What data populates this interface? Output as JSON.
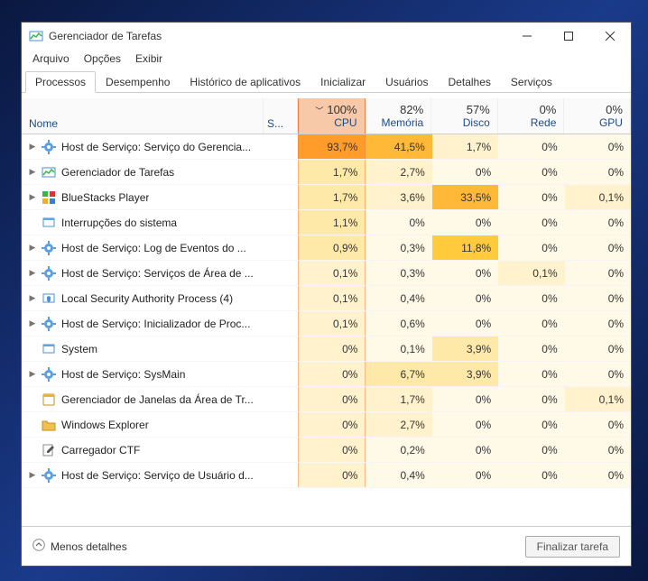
{
  "window": {
    "title": "Gerenciador de Tarefas"
  },
  "menu": {
    "arquivo": "Arquivo",
    "opcoes": "Opções",
    "exibir": "Exibir"
  },
  "tabs": {
    "processos": "Processos",
    "desempenho": "Desempenho",
    "historico": "Histórico de aplicativos",
    "inicializar": "Inicializar",
    "usuarios": "Usuários",
    "detalhes": "Detalhes",
    "servicos": "Serviços"
  },
  "headers": {
    "nome": "Nome",
    "status": "S...",
    "cpu_pct": "100%",
    "cpu_label": "CPU",
    "mem_pct": "82%",
    "mem_label": "Memória",
    "disk_pct": "57%",
    "disk_label": "Disco",
    "net_pct": "0%",
    "net_label": "Rede",
    "gpu_pct": "0%",
    "gpu_label": "GPU"
  },
  "rows": [
    {
      "expand": true,
      "icon": "gear",
      "name": "Host de Serviço: Serviço do Gerencia...",
      "cpu": "93,7%",
      "ch": 6,
      "mem": "41,5%",
      "mh": 5,
      "disk": "1,7%",
      "dh": 1,
      "net": "0%",
      "nh": 0,
      "gpu": "0%",
      "gh": 0
    },
    {
      "expand": true,
      "icon": "tm",
      "name": "Gerenciador de Tarefas",
      "cpu": "1,7%",
      "ch": 2,
      "mem": "2,7%",
      "mh": 1,
      "disk": "0%",
      "dh": 0,
      "net": "0%",
      "nh": 0,
      "gpu": "0%",
      "gh": 0
    },
    {
      "expand": true,
      "icon": "bs",
      "name": "BlueStacks Player",
      "cpu": "1,7%",
      "ch": 2,
      "mem": "3,6%",
      "mh": 1,
      "disk": "33,5%",
      "dh": 5,
      "net": "0%",
      "nh": 0,
      "gpu": "0,1%",
      "gh": 1
    },
    {
      "expand": false,
      "icon": "sys",
      "name": "Interrupções do sistema",
      "cpu": "1,1%",
      "ch": 2,
      "mem": "0%",
      "mh": 0,
      "disk": "0%",
      "dh": 0,
      "net": "0%",
      "nh": 0,
      "gpu": "0%",
      "gh": 0
    },
    {
      "expand": true,
      "icon": "gear",
      "name": "Host de Serviço: Log de Eventos do ...",
      "cpu": "0,9%",
      "ch": 2,
      "mem": "0,3%",
      "mh": 0,
      "disk": "11,8%",
      "dh": 4,
      "net": "0%",
      "nh": 0,
      "gpu": "0%",
      "gh": 0
    },
    {
      "expand": true,
      "icon": "gear",
      "name": "Host de Serviço: Serviços de Área de ...",
      "cpu": "0,1%",
      "ch": 1,
      "mem": "0,3%",
      "mh": 0,
      "disk": "0%",
      "dh": 0,
      "net": "0,1%",
      "nh": 1,
      "gpu": "0%",
      "gh": 0
    },
    {
      "expand": true,
      "icon": "shield",
      "name": "Local Security Authority Process (4)",
      "cpu": "0,1%",
      "ch": 1,
      "mem": "0,4%",
      "mh": 0,
      "disk": "0%",
      "dh": 0,
      "net": "0%",
      "nh": 0,
      "gpu": "0%",
      "gh": 0
    },
    {
      "expand": true,
      "icon": "gear",
      "name": "Host de Serviço: Inicializador de Proc...",
      "cpu": "0,1%",
      "ch": 1,
      "mem": "0,6%",
      "mh": 0,
      "disk": "0%",
      "dh": 0,
      "net": "0%",
      "nh": 0,
      "gpu": "0%",
      "gh": 0
    },
    {
      "expand": false,
      "icon": "sys",
      "name": "System",
      "cpu": "0%",
      "ch": 1,
      "mem": "0,1%",
      "mh": 0,
      "disk": "3,9%",
      "dh": 2,
      "net": "0%",
      "nh": 0,
      "gpu": "0%",
      "gh": 0
    },
    {
      "expand": true,
      "icon": "gear",
      "name": "Host de Serviço: SysMain",
      "cpu": "0%",
      "ch": 1,
      "mem": "6,7%",
      "mh": 2,
      "disk": "3,9%",
      "dh": 2,
      "net": "0%",
      "nh": 0,
      "gpu": "0%",
      "gh": 0
    },
    {
      "expand": false,
      "icon": "win",
      "name": "Gerenciador de Janelas da Área de Tr...",
      "cpu": "0%",
      "ch": 1,
      "mem": "1,7%",
      "mh": 1,
      "disk": "0%",
      "dh": 0,
      "net": "0%",
      "nh": 0,
      "gpu": "0,1%",
      "gh": 1
    },
    {
      "expand": false,
      "icon": "explorer",
      "name": "Windows Explorer",
      "cpu": "0%",
      "ch": 1,
      "mem": "2,7%",
      "mh": 1,
      "disk": "0%",
      "dh": 0,
      "net": "0%",
      "nh": 0,
      "gpu": "0%",
      "gh": 0
    },
    {
      "expand": false,
      "icon": "pen",
      "name": "Carregador CTF",
      "cpu": "0%",
      "ch": 1,
      "mem": "0,2%",
      "mh": 0,
      "disk": "0%",
      "dh": 0,
      "net": "0%",
      "nh": 0,
      "gpu": "0%",
      "gh": 0
    },
    {
      "expand": true,
      "icon": "gear",
      "name": "Host de Serviço: Serviço de Usuário d...",
      "cpu": "0%",
      "ch": 1,
      "mem": "0,4%",
      "mh": 0,
      "disk": "0%",
      "dh": 0,
      "net": "0%",
      "nh": 0,
      "gpu": "0%",
      "gh": 0
    }
  ],
  "footer": {
    "fewer": "Menos detalhes",
    "end": "Finalizar tarefa"
  }
}
